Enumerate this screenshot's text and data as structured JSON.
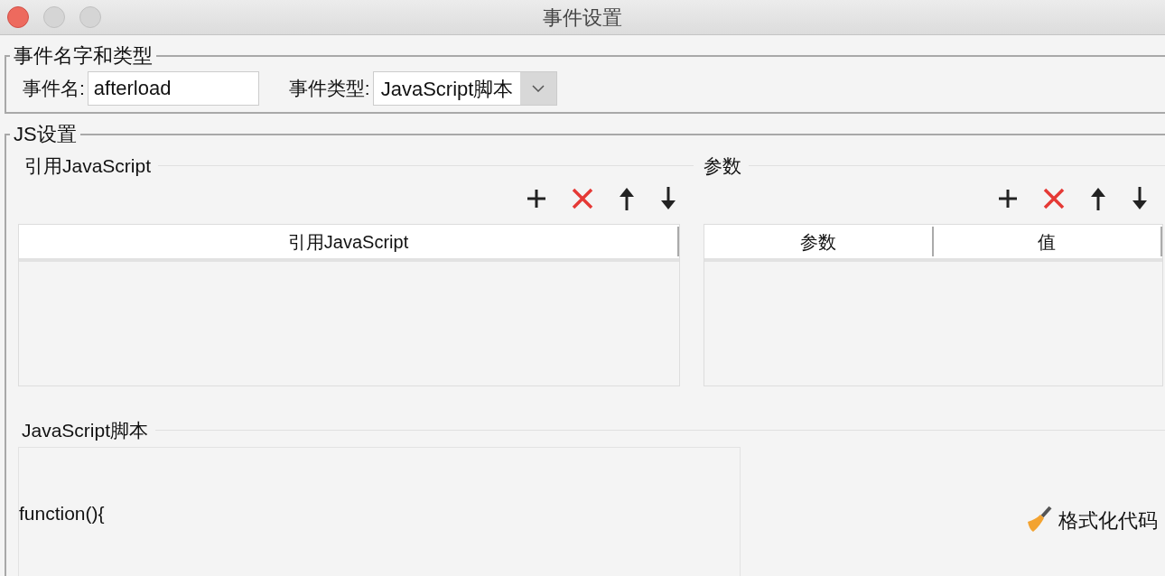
{
  "window": {
    "title": "事件设置"
  },
  "event_group": {
    "title": "事件名字和类型",
    "name_label": "事件名:",
    "name_value": "afterload",
    "type_label": "事件类型:",
    "type_value": "JavaScript脚本"
  },
  "js_group": {
    "title": "JS设置",
    "references": {
      "title": "引用JavaScript",
      "columns": [
        "引用JavaScript"
      ]
    },
    "parameters": {
      "title": "参数",
      "columns": [
        "参数",
        "值"
      ]
    },
    "script": {
      "title": "JavaScript脚本",
      "lines": [
        "function(){"
      ]
    },
    "format_button": "格式化代码"
  }
}
